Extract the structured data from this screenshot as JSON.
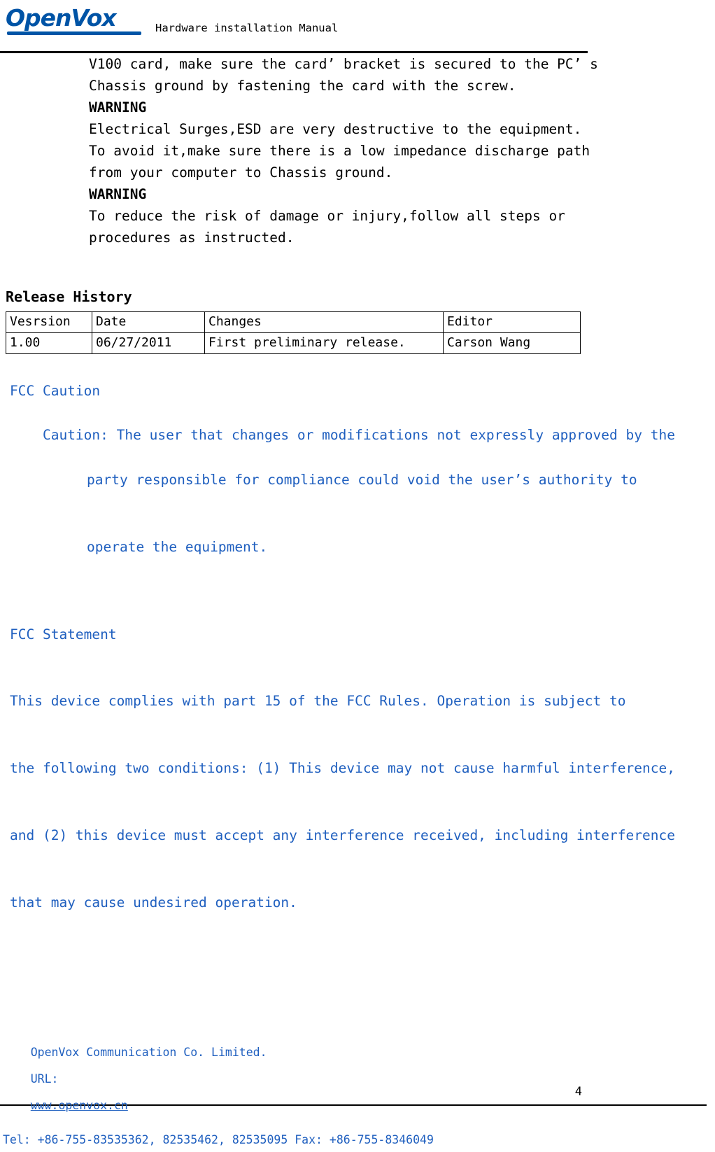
{
  "header": {
    "logo_text": "OpenVox",
    "title": "Hardware installation Manual"
  },
  "body": {
    "intro_lines": [
      "V100 card, make sure the card’ bracket is secured to the PC’ s",
      "Chassis ground by fastening the card with the screw."
    ],
    "warning1_label": "WARNING",
    "warning1_lines": [
      "Electrical Surges,ESD are very destructive to the equipment.",
      "To avoid it,make sure there is a low impedance discharge path",
      "from your computer to Chassis ground."
    ],
    "warning2_label": "WARNING",
    "warning2_lines": [
      "To reduce the risk of damage or injury,follow all steps or",
      "procedures as instructed."
    ]
  },
  "release_history": {
    "title": "Release History",
    "columns": [
      "Vesrsion",
      "Date",
      "Changes",
      "Editor"
    ],
    "rows": [
      [
        "1.00",
        "06/27/2011",
        "First preliminary release.",
        "Carson Wang"
      ]
    ]
  },
  "fcc_caution": {
    "title": "FCC Caution",
    "line1": "Caution: The user that changes or modifications not expressly approved by the",
    "line2": "party responsible for compliance could void the user’s authority to",
    "line3": "operate the equipment."
  },
  "fcc_statement": {
    "title": "FCC Statement",
    "lines": [
      "This device complies with part 15 of the FCC Rules. Operation is subject to",
      "the following two conditions: (1) This device may not cause harmful interference,",
      "and (2) this device must accept any interference received, including interference",
      "that may cause undesired operation."
    ]
  },
  "footer": {
    "page_number": "4",
    "company_prefix": "OpenVox Communication Co. Limited.",
    "url_label": "URL:",
    "url": "www.openvox.cn",
    "contact": "Tel: +86-755-83535362, 82535462, 82535095 Fax: +86-755-8346049"
  }
}
